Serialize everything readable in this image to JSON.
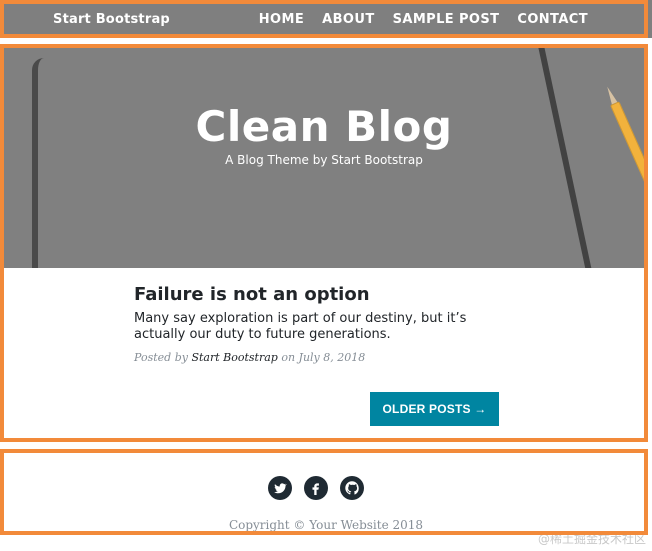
{
  "navbar": {
    "brand": "Start Bootstrap",
    "links": [
      "HOME",
      "ABOUT",
      "SAMPLE POST",
      "CONTACT"
    ]
  },
  "hero": {
    "title": "Clean Blog",
    "subtitle": "A Blog Theme by Start Bootstrap"
  },
  "post": {
    "title": "Failure is not an option",
    "subtitle": "Many say exploration is part of our destiny, but it’s actually our duty to future generations.",
    "meta_prefix": "Posted by",
    "author": "Start Bootstrap",
    "meta_suffix": "on July 8, 2018"
  },
  "pager": {
    "older_label": "OLDER POSTS →"
  },
  "footer": {
    "social_icons": [
      "twitter-icon",
      "facebook-icon",
      "github-icon"
    ],
    "copyright": "Copyright © Your Website 2018"
  },
  "watermark": "@稀土掘金技术社区",
  "colors": {
    "accent": "#0085a1",
    "overlay_orange": "#f28a3a",
    "text_dark": "#212529",
    "text_muted": "#868e96"
  }
}
